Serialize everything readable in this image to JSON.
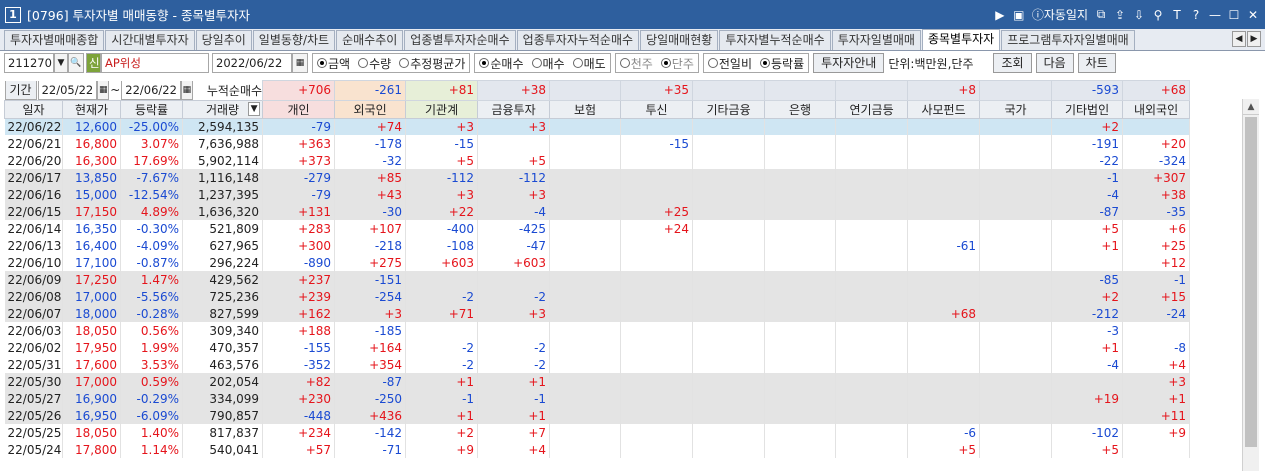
{
  "title": {
    "window_number": "1",
    "text": "[0796] 투자자별 매매동향 - 종목별투자자",
    "buttons": {
      "prev": "▶",
      "memo": "▣",
      "auto_log_icon": "ⓘ",
      "auto_log": "자동일지",
      "link": "⧉",
      "upload": "⇪",
      "download": "⇩",
      "pin": "⚲",
      "font": "T",
      "help": "?",
      "minimize": "—",
      "maximize": "☐",
      "close": "✕"
    }
  },
  "tabs": [
    {
      "label": "투자자별매매종합",
      "active": false
    },
    {
      "label": "시간대별투자자",
      "active": false
    },
    {
      "label": "당일추이",
      "active": false
    },
    {
      "label": "일별동향/차트",
      "active": false
    },
    {
      "label": "순매수추이",
      "active": false
    },
    {
      "label": "업종별투자자순매수",
      "active": false
    },
    {
      "label": "업종투자자누적순매수",
      "active": false
    },
    {
      "label": "당일매매현황",
      "active": false
    },
    {
      "label": "투자자별누적순매수",
      "active": false
    },
    {
      "label": "투자자일별매매",
      "active": false
    },
    {
      "label": "종목별투자자",
      "active": true
    },
    {
      "label": "프로그램투자자일별매매",
      "active": false
    }
  ],
  "tab_nav": {
    "prev": "◀",
    "next": "▶"
  },
  "controls": {
    "code": "211270",
    "code_dropdown": "▼",
    "search_icon": "🔍",
    "new_badge": "신",
    "stock_name": "AP위성",
    "date": "2022/06/22",
    "calendar_icon": "▦",
    "unit_group": [
      {
        "label": "금액",
        "on": true
      },
      {
        "label": "수량",
        "on": false
      },
      {
        "label": "추정평균가",
        "on": false
      }
    ],
    "trade_group": [
      {
        "label": "순매수",
        "on": true
      },
      {
        "label": "매수",
        "on": false
      },
      {
        "label": "매도",
        "on": false
      }
    ],
    "share_group": [
      {
        "label": "천주",
        "on": false,
        "disabled": true
      },
      {
        "label": "단주",
        "on": true,
        "disabled": true
      }
    ],
    "compare_group": [
      {
        "label": "전일비",
        "on": false
      },
      {
        "label": "등락률",
        "on": true
      }
    ],
    "investor_info": "투자자안내",
    "unit_text": "단위:백만원,단주",
    "query": "조회",
    "next": "다음",
    "chart": "차트"
  },
  "period": {
    "label": "기간",
    "from": "22/05/22",
    "sep": "~",
    "to": "22/06/22",
    "cum_label": "누적순매수"
  },
  "cumulative": [
    "+706",
    "-261",
    "+81",
    "+38",
    "",
    "+35",
    "",
    "",
    "",
    "+8",
    "",
    "-593",
    "+68"
  ],
  "columns": [
    "일자",
    "현재가",
    "등락률",
    "거래량",
    "개인",
    "외국인",
    "기관계",
    "금융투자",
    "보험",
    "투신",
    "기타금융",
    "은행",
    "연기금등",
    "사모펀드",
    "국가",
    "기타법인",
    "내외국인"
  ],
  "sort_icon": "▼",
  "rows": [
    [
      "22/06/22",
      "12,600",
      "-25.00%",
      "2,594,135",
      "-79",
      "+74",
      "+3",
      "+3",
      "",
      "",
      "",
      "",
      "",
      "",
      "",
      "+2",
      ""
    ],
    [
      "22/06/21",
      "16,800",
      "3.07%",
      "7,636,988",
      "+363",
      "-178",
      "-15",
      "",
      "",
      "-15",
      "",
      "",
      "",
      "",
      "",
      "-191",
      "+20"
    ],
    [
      "22/06/20",
      "16,300",
      "17.69%",
      "5,902,114",
      "+373",
      "-32",
      "+5",
      "+5",
      "",
      "",
      "",
      "",
      "",
      "",
      "",
      "-22",
      "-324"
    ],
    [
      "22/06/17",
      "13,850",
      "-7.67%",
      "1,116,148",
      "-279",
      "+85",
      "-112",
      "-112",
      "",
      "",
      "",
      "",
      "",
      "",
      "",
      "-1",
      "+307"
    ],
    [
      "22/06/16",
      "15,000",
      "-12.54%",
      "1,237,395",
      "-79",
      "+43",
      "+3",
      "+3",
      "",
      "",
      "",
      "",
      "",
      "",
      "",
      "-4",
      "+38"
    ],
    [
      "22/06/15",
      "17,150",
      "4.89%",
      "1,636,320",
      "+131",
      "-30",
      "+22",
      "-4",
      "",
      "+25",
      "",
      "",
      "",
      "",
      "",
      "-87",
      "-35"
    ],
    [
      "22/06/14",
      "16,350",
      "-0.30%",
      "521,809",
      "+283",
      "+107",
      "-400",
      "-425",
      "",
      "+24",
      "",
      "",
      "",
      "",
      "",
      "+5",
      "+6"
    ],
    [
      "22/06/13",
      "16,400",
      "-4.09%",
      "627,965",
      "+300",
      "-218",
      "-108",
      "-47",
      "",
      "",
      "",
      "",
      "",
      "-61",
      "",
      "+1",
      "+25"
    ],
    [
      "22/06/10",
      "17,100",
      "-0.87%",
      "296,224",
      "-890",
      "+275",
      "+603",
      "+603",
      "",
      "",
      "",
      "",
      "",
      "",
      "",
      "",
      "+12"
    ],
    [
      "22/06/09",
      "17,250",
      "1.47%",
      "429,562",
      "+237",
      "-151",
      "",
      "",
      "",
      "",
      "",
      "",
      "",
      "",
      "",
      "-85",
      "-1"
    ],
    [
      "22/06/08",
      "17,000",
      "-5.56%",
      "725,236",
      "+239",
      "-254",
      "-2",
      "-2",
      "",
      "",
      "",
      "",
      "",
      "",
      "",
      "+2",
      "+15"
    ],
    [
      "22/06/07",
      "18,000",
      "-0.28%",
      "827,599",
      "+162",
      "+3",
      "+71",
      "+3",
      "",
      "",
      "",
      "",
      "",
      "+68",
      "",
      "-212",
      "-24"
    ],
    [
      "22/06/03",
      "18,050",
      "0.56%",
      "309,340",
      "+188",
      "-185",
      "",
      "",
      "",
      "",
      "",
      "",
      "",
      "",
      "",
      "-3",
      ""
    ],
    [
      "22/06/02",
      "17,950",
      "1.99%",
      "470,357",
      "-155",
      "+164",
      "-2",
      "-2",
      "",
      "",
      "",
      "",
      "",
      "",
      "",
      "+1",
      "-8"
    ],
    [
      "22/05/31",
      "17,600",
      "3.53%",
      "463,576",
      "-352",
      "+354",
      "-2",
      "-2",
      "",
      "",
      "",
      "",
      "",
      "",
      "",
      "-4",
      "+4"
    ],
    [
      "22/05/30",
      "17,000",
      "0.59%",
      "202,054",
      "+82",
      "-87",
      "+1",
      "+1",
      "",
      "",
      "",
      "",
      "",
      "",
      "",
      "",
      "+3"
    ],
    [
      "22/05/27",
      "16,900",
      "-0.29%",
      "334,099",
      "+230",
      "-250",
      "-1",
      "-1",
      "",
      "",
      "",
      "",
      "",
      "",
      "",
      "+19",
      "+1"
    ],
    [
      "22/05/26",
      "16,950",
      "-6.09%",
      "790,857",
      "-448",
      "+436",
      "+1",
      "+1",
      "",
      "",
      "",
      "",
      "",
      "",
      "",
      "",
      "+11"
    ],
    [
      "22/05/25",
      "18,050",
      "1.40%",
      "817,837",
      "+234",
      "-142",
      "+2",
      "+7",
      "",
      "",
      "",
      "",
      "",
      "-6",
      "",
      "-102",
      "+9"
    ],
    [
      "22/05/24",
      "17,800",
      "1.14%",
      "540,041",
      "+57",
      "-71",
      "+9",
      "+4",
      "",
      "",
      "",
      "",
      "",
      "+5",
      "",
      "+5",
      ""
    ]
  ],
  "row_bands": [
    "sel",
    "white",
    "white",
    "gray",
    "gray",
    "gray",
    "white",
    "white",
    "white",
    "gray",
    "gray",
    "gray",
    "white",
    "white",
    "white",
    "gray",
    "gray",
    "gray",
    "white",
    "white"
  ],
  "colors": {
    "up": "#e5141b",
    "down": "#1a4ad2",
    "titlebar": "#2e5f9e",
    "selected_row": "#cfe6f3",
    "band": "#e4e4e4"
  },
  "scrollbar": {
    "up_arrow": "▲"
  }
}
